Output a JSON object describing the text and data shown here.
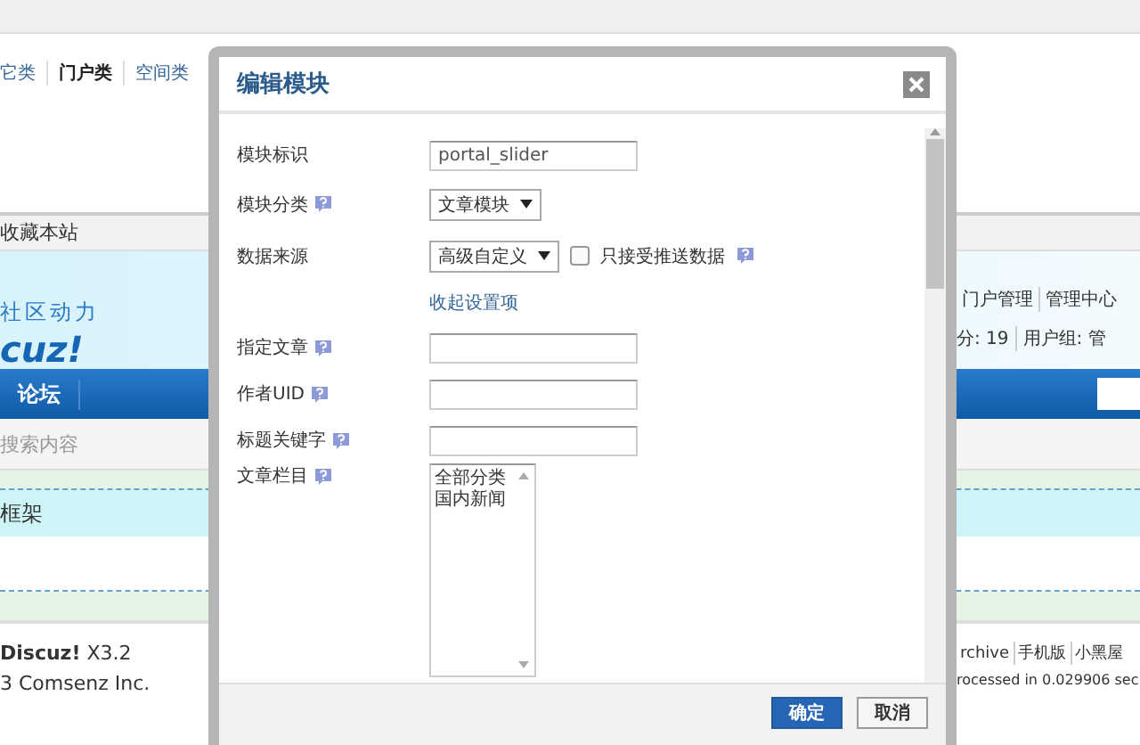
{
  "page": {
    "category_tabs": [
      {
        "label": "它类",
        "selected": false
      },
      {
        "label": "门户类",
        "selected": true
      },
      {
        "label": "空间类",
        "selected": false
      }
    ],
    "bookmark_link": "收藏本站",
    "slogan": "社区动力",
    "logo": "cuz!",
    "user_links": [
      "门户管理",
      "管理中心"
    ],
    "credits": "分: 19",
    "user_group": "用户组: 管",
    "nav_item": "论坛",
    "search_placeholder": "搜索内容",
    "frame_title": "框架",
    "footer_left": [
      "**Discuz!** X3.2",
      "3 Comsenz Inc."
    ],
    "footer_links": [
      "rchive",
      "手机版",
      "小黑屋"
    ],
    "footer_stats": "rocessed in 0.029906 sec"
  },
  "dialog": {
    "title": "编辑模块",
    "fields": [
      {
        "kind": "text",
        "label": "模块标识",
        "value": "portal_slider",
        "help": false
      },
      {
        "kind": "select",
        "label": "模块分类",
        "value": "文章模块",
        "help": true
      },
      {
        "kind": "select",
        "label": "数据来源",
        "value": "高级自定义",
        "help": false,
        "option": {
          "label": "只接受推送数据",
          "checked": false,
          "help": true
        }
      },
      {
        "kind": "link",
        "label": "收起设置项"
      },
      {
        "kind": "text",
        "label": "指定文章",
        "help": true
      },
      {
        "kind": "text",
        "label": "作者UID",
        "help": true
      },
      {
        "kind": "text",
        "label": "标题关键字",
        "help": true
      },
      {
        "kind": "multiselect",
        "label": "文章栏目",
        "help": true,
        "options": [
          "全部分类",
          "国内新闻"
        ]
      }
    ],
    "buttons": [
      {
        "label": "确定",
        "kind": "primary"
      },
      {
        "label": "取消",
        "kind": "secondary"
      }
    ]
  }
}
